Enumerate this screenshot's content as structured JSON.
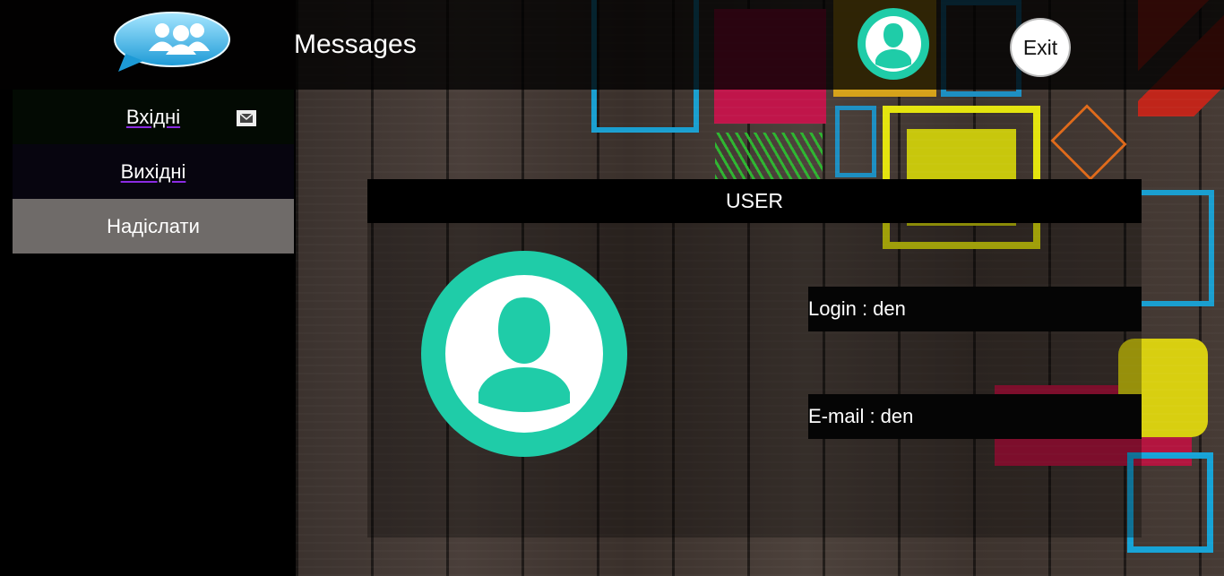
{
  "header": {
    "app_icon": "chat-bubble-users-icon",
    "title": "Messages",
    "profile_icon": "user-avatar-icon",
    "exit_label": "Exit"
  },
  "sidebar": {
    "items": [
      {
        "label": "Вхідні",
        "icon": "envelope-icon",
        "active": false
      },
      {
        "label": "Вихідні",
        "active": false
      },
      {
        "label": "Надіслати",
        "active": true
      }
    ]
  },
  "profile": {
    "header": "USER",
    "avatar_icon": "user-avatar-icon",
    "login_text": "Login : den",
    "email_text": "E-mail : den"
  },
  "colors": {
    "accent_teal": "#1fcca8",
    "logo_blue": "#3fb5e8",
    "sidebar_active": "#6f6b69",
    "link_underline": "#8a2be2"
  }
}
